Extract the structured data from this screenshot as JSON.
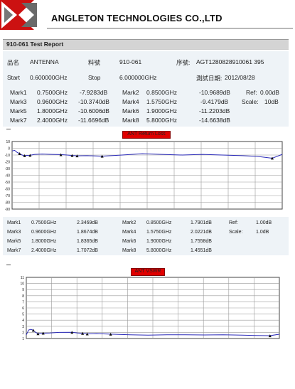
{
  "header": {
    "company": "ANGLETON TECHNOLOGIES CO.,LTD"
  },
  "report": {
    "title": "910-061  Test Report"
  },
  "info": {
    "name_label": "品名",
    "name_value": "ANTENNA",
    "part_label": "料號",
    "part_value": "910-061",
    "serial_label": "序號:",
    "serial_value": "AGT1280828910061 395",
    "start_label": "Start",
    "start_value": "0.600000GHz",
    "stop_label": "Stop",
    "stop_value": "6.000000GHz",
    "date_label": "測試日期:",
    "date_value": "2012/08/28"
  },
  "markers_return_loss": [
    {
      "label": "Mark1",
      "freq": "0.7500GHz",
      "value": "-7.9283dB"
    },
    {
      "label": "Mark2",
      "freq": "0.8500GHz",
      "value": "-10.9689dB"
    },
    {
      "label": "Mark3",
      "freq": "0.9600GHz",
      "value": "-10.3740dB"
    },
    {
      "label": "Mark4",
      "freq": "1.5750GHz",
      "value": "-9.4179dB"
    },
    {
      "label": "Mark5",
      "freq": "1.8000GHz",
      "value": "-10.6006dB"
    },
    {
      "label": "Mark6",
      "freq": "1.9000GHz",
      "value": "-11.2203dB"
    },
    {
      "label": "Mark7",
      "freq": "2.4000GHz",
      "value": "-11.6696dB"
    },
    {
      "label": "Mark8",
      "freq": "5.8000GHz",
      "value": "-14.6638dB"
    }
  ],
  "rl_settings": {
    "ref_label": "Ref:",
    "ref_value": "0.00dB",
    "scale_label": "Scale:",
    "scale_value": "10dB"
  },
  "markers_vswr": [
    {
      "label": "Mark1",
      "freq": "0.7500GHz",
      "value": "2.3469dB"
    },
    {
      "label": "Mark2",
      "freq": "0.8500GHz",
      "value": "1.7901dB"
    },
    {
      "label": "Mark3",
      "freq": "0.9600GHz",
      "value": "1.8674dB"
    },
    {
      "label": "Mark4",
      "freq": "1.5750GHz",
      "value": "2.0221dB"
    },
    {
      "label": "Mark5",
      "freq": "1.8000GHz",
      "value": "1.8365dB"
    },
    {
      "label": "Mark6",
      "freq": "1.9000GHz",
      "value": "1.7558dB"
    },
    {
      "label": "Mark7",
      "freq": "2.4000GHz",
      "value": "1.7072dB"
    },
    {
      "label": "Mark8",
      "freq": "5.8000GHz",
      "value": "1.4551dB"
    }
  ],
  "vswr_settings": {
    "ref_label": "Ref:",
    "ref_value": "1.00dB",
    "scale_label": "Scale:",
    "scale_value": "1.0dB"
  },
  "chart_data": [
    {
      "type": "line",
      "title": "ANT Return Loss",
      "yticks": [
        "10",
        "0",
        "-10",
        "-20",
        "-30",
        "-40",
        "-50",
        "-60",
        "-70",
        "-80",
        "-90"
      ],
      "ylim": [
        -90,
        10
      ],
      "xlim": [
        0.6,
        6.0
      ],
      "grid": true,
      "series": [
        {
          "color": "#2a2ab8",
          "x": [
            0.6,
            0.65,
            0.7,
            0.75,
            0.8,
            0.85,
            0.9,
            0.96,
            1.05,
            1.2,
            1.4,
            1.575,
            1.7,
            1.8,
            1.9,
            2.1,
            2.4,
            2.8,
            3.2,
            3.6,
            4.0,
            4.4,
            4.8,
            5.2,
            5.5,
            5.8,
            6.0
          ],
          "y": [
            -4,
            -3,
            -6,
            -7.9,
            -10,
            -11,
            -10.5,
            -10.4,
            -9,
            -8.5,
            -9,
            -9.4,
            -10,
            -10.6,
            -11.2,
            -11,
            -11.7,
            -10,
            -8,
            -9,
            -10,
            -9,
            -10,
            -11,
            -12,
            -14.7,
            -9
          ]
        }
      ],
      "markers_x": [
        0.75,
        0.85,
        0.96,
        1.575,
        1.8,
        1.9,
        2.4,
        5.8
      ],
      "markers_y": [
        -7.9283,
        -10.9689,
        -10.374,
        -9.4179,
        -10.6006,
        -11.2203,
        -11.6696,
        -14.6638
      ]
    },
    {
      "type": "line",
      "title": "ANT VSWR",
      "yticks": [
        "11",
        "10",
        "9",
        "8",
        "7",
        "6",
        "5",
        "4",
        "3",
        "2",
        "1"
      ],
      "ylim": [
        1,
        11
      ],
      "xlim": [
        0.6,
        6.0
      ],
      "grid": true,
      "series": [
        {
          "color": "#2a2ab8",
          "x": [
            0.6,
            0.65,
            0.7,
            0.75,
            0.8,
            0.85,
            0.9,
            0.96,
            1.1,
            1.3,
            1.575,
            1.7,
            1.8,
            1.9,
            2.1,
            2.4,
            2.8,
            3.2,
            3.6,
            4.0,
            4.4,
            4.8,
            5.2,
            5.5,
            5.8,
            6.0
          ],
          "y": [
            1.6,
            2.4,
            2.5,
            2.35,
            2.0,
            1.8,
            1.85,
            1.87,
            1.9,
            2.0,
            2.02,
            1.9,
            1.84,
            1.76,
            1.8,
            1.71,
            1.6,
            1.55,
            1.6,
            1.62,
            1.58,
            1.6,
            1.55,
            1.5,
            1.46,
            1.7
          ]
        }
      ],
      "markers_x": [
        0.75,
        0.85,
        0.96,
        1.575,
        1.8,
        1.9,
        2.4,
        5.8
      ],
      "markers_y": [
        2.3469,
        1.7901,
        1.8674,
        2.0221,
        1.8365,
        1.7558,
        1.7072,
        1.4551
      ]
    }
  ]
}
